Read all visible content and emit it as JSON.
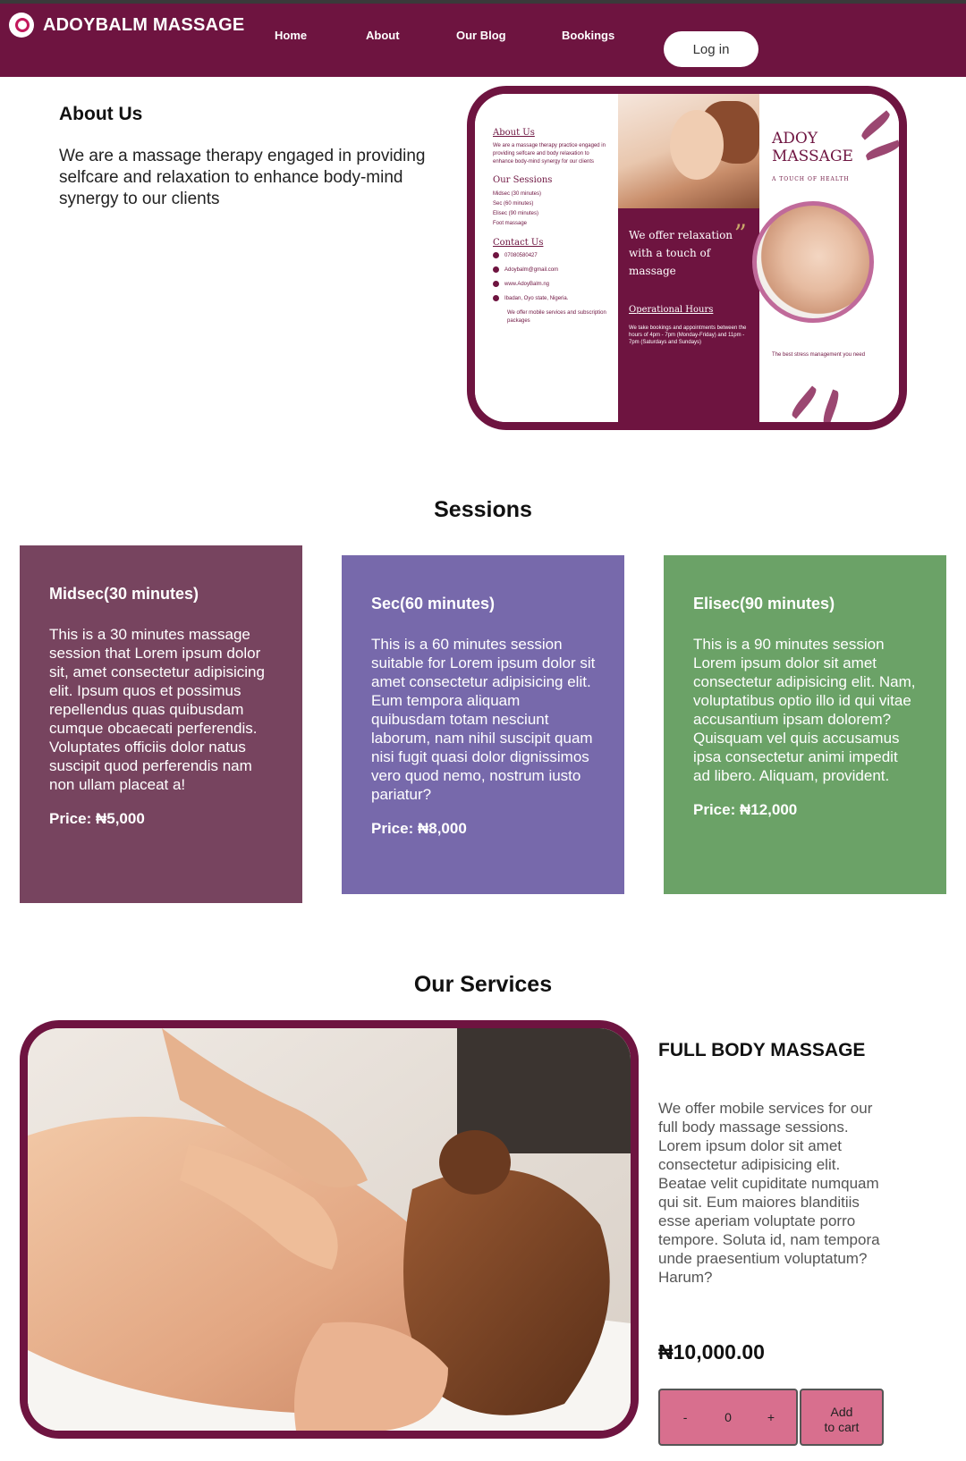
{
  "colors": {
    "brand": "#6e1440",
    "session1_bg": "#77445f",
    "session2_bg": "#7769ab",
    "session3_bg": "#6ba267",
    "accent_button": "#d86f8e"
  },
  "nav": {
    "brand": "ADOYBALM MASSAGE",
    "links": [
      "Home",
      "About",
      "Our Blog",
      "Bookings"
    ],
    "login": "Log in"
  },
  "about": {
    "title": "About Us",
    "text": "We are a massage therapy engaged in providing selfcare and relaxation to enhance body-mind synergy to our clients"
  },
  "brochure": {
    "left": {
      "about_heading": "About Us",
      "about_text": "We are a massage therapy practice engaged in providing selfcare and body relaxation to enhance body-mind synergy for our clients",
      "sessions_heading": "Our Sessions",
      "sessions": [
        "Midsec (30 minutes)",
        "Sec (60 minutes)",
        "Elisec (90 minutes)",
        "Foot massage"
      ],
      "contact_heading": "Contact Us",
      "contacts": [
        "07080580427",
        "Adoybalm@gmail.com",
        "www.AdoyBalm.ng",
        "Ibadan, Oyo state, Nigeria."
      ],
      "footer": "We offer mobile services and subscription packages"
    },
    "mid": {
      "tagline": "We offer relaxation with a touch of massage",
      "hours_heading": "Operational Hours",
      "hours_text": "We take bookings and appointments between the hours of 4pm - 7pm (Monday-Friday) and 11pm - 7pm (Saturdays and Sundays)"
    },
    "right": {
      "brand_line1": "ADOY",
      "brand_line2": "MASSAGE",
      "brand_tag": "A TOUCH OF HEALTH",
      "footer": "The best stress management you need"
    }
  },
  "sessions": {
    "title": "Sessions",
    "cards": [
      {
        "title": "Midsec(30 minutes)",
        "text": "This is a 30 minutes massage session that Lorem ipsum dolor sit, amet consectetur adipisicing elit. Ipsum quos et possimus repellendus quas quibusdam cumque obcaecati perferendis. Voluptates officiis dolor natus suscipit quod perferendis nam non ullam placeat a!",
        "price": "Price: ₦5,000"
      },
      {
        "title": "Sec(60 minutes)",
        "text": "This is a 60 minutes session suitable for Lorem ipsum dolor sit amet consectetur adipisicing elit. Eum tempora aliquam quibusdam totam nesciunt laborum, nam nihil suscipit quam nisi fugit quasi dolor dignissimos vero quod nemo, nostrum iusto pariatur?",
        "price": "Price: ₦8,000"
      },
      {
        "title": "Elisec(90 minutes)",
        "text": "This is a 90 minutes session Lorem ipsum dolor sit amet consectetur adipisicing elit. Nam, voluptatibus optio illo id qui vitae accusantium ipsam dolorem? Quisquam vel quis accusamus ipsa consectetur animi impedit ad libero. Aliquam, provident.",
        "price": "Price: ₦12,000"
      }
    ]
  },
  "services": {
    "title": "Our Services",
    "item": {
      "name": "FULL BODY MASSAGE",
      "description": "We offer mobile services for our full body massage sessions. Lorem ipsum dolor sit amet consectetur adipisicing elit. Beatae velit cupiditate numquam qui sit. Eum maiores blanditiis esse aperiam voluptate porro tempore. Soluta id, nam tempora unde praesentium voluptatum? Harum?",
      "price": "₦10,000.00",
      "qty_minus": "-",
      "qty_value": "0",
      "qty_plus": "+",
      "add_to_cart": "Add to cart"
    }
  }
}
